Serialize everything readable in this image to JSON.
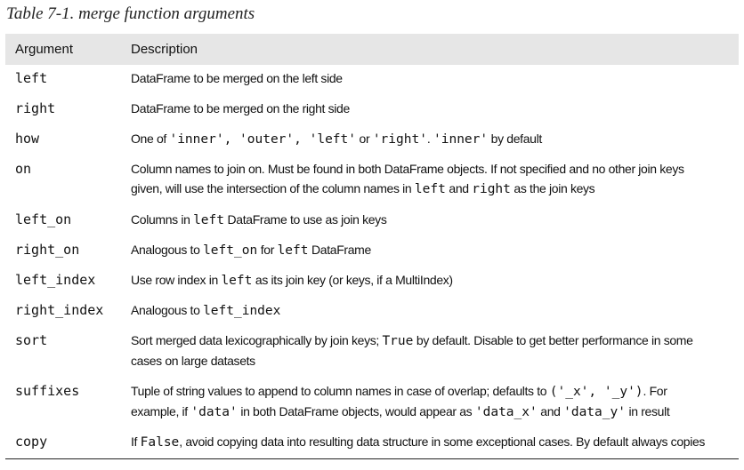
{
  "caption": "Table 7-1. merge function arguments",
  "table": {
    "headers": {
      "argument": "Argument",
      "description": "Description"
    },
    "rows": [
      {
        "arg": "left",
        "desc": [
          [
            {
              "t": "DataFrame to be merged on the left side"
            }
          ]
        ]
      },
      {
        "arg": "right",
        "desc": [
          [
            {
              "t": "DataFrame to be merged on the right side"
            }
          ]
        ]
      },
      {
        "arg": "how",
        "desc": [
          [
            {
              "t": "One of "
            },
            {
              "t": "'inner', 'outer', 'left'",
              "m": true
            },
            {
              "t": " or "
            },
            {
              "t": "'right'",
              "m": true
            },
            {
              "t": ". "
            },
            {
              "t": "'inner'",
              "m": true
            },
            {
              "t": " by default"
            }
          ]
        ]
      },
      {
        "arg": "on",
        "desc": [
          [
            {
              "t": "Column names to join on. Must be found in both DataFrame objects. If not specified and no other join keys"
            }
          ],
          [
            {
              "t": "given, will use the intersection of the column names in "
            },
            {
              "t": "left",
              "m": true
            },
            {
              "t": " and "
            },
            {
              "t": "right",
              "m": true
            },
            {
              "t": " as the join keys"
            }
          ]
        ]
      },
      {
        "arg": "left_on",
        "desc": [
          [
            {
              "t": "Columns in "
            },
            {
              "t": "left",
              "m": true
            },
            {
              "t": " DataFrame to use as join keys"
            }
          ]
        ]
      },
      {
        "arg": "right_on",
        "desc": [
          [
            {
              "t": "Analogous to "
            },
            {
              "t": "left_on",
              "m": true
            },
            {
              "t": " for "
            },
            {
              "t": "left",
              "m": true
            },
            {
              "t": " DataFrame"
            }
          ]
        ]
      },
      {
        "arg": "left_index",
        "desc": [
          [
            {
              "t": "Use row index in "
            },
            {
              "t": "left",
              "m": true
            },
            {
              "t": " as its join key (or keys, if a MultiIndex)"
            }
          ]
        ]
      },
      {
        "arg": "right_index",
        "desc": [
          [
            {
              "t": "Analogous to "
            },
            {
              "t": "left_index",
              "m": true
            }
          ]
        ]
      },
      {
        "arg": "sort",
        "desc": [
          [
            {
              "t": "Sort merged data lexicographically by join keys; "
            },
            {
              "t": "True",
              "m": true
            },
            {
              "t": " by default. Disable to get better performance in some"
            }
          ],
          [
            {
              "t": "cases on large datasets"
            }
          ]
        ]
      },
      {
        "arg": "suffixes",
        "desc": [
          [
            {
              "t": "Tuple of string values to append to column names in case of overlap; defaults to "
            },
            {
              "t": "('_x', '_y')",
              "m": true
            },
            {
              "t": ". For"
            }
          ],
          [
            {
              "t": "example, if "
            },
            {
              "t": "'data'",
              "m": true
            },
            {
              "t": " in both DataFrame objects, would appear as "
            },
            {
              "t": "'data_x'",
              "m": true
            },
            {
              "t": " and "
            },
            {
              "t": "'data_y'",
              "m": true
            },
            {
              "t": " in result"
            }
          ]
        ]
      },
      {
        "arg": "copy",
        "desc": [
          [
            {
              "t": "If "
            },
            {
              "t": "False",
              "m": true
            },
            {
              "t": ", avoid copying data into resulting data structure in some exceptional cases. By default always copies"
            }
          ]
        ]
      }
    ]
  }
}
